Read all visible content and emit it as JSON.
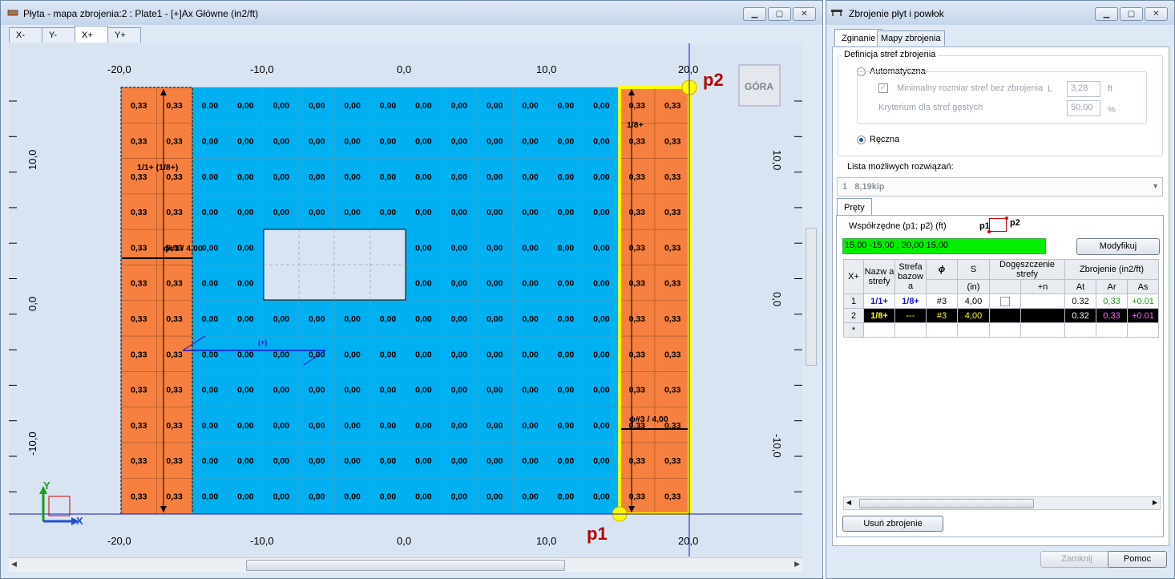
{
  "left_window": {
    "title": "Płyta - mapa zbrojenia:2 : Plate1 - [+]Ax Główne (in2/ft)",
    "tabs": [
      "X-",
      "Y-",
      "X+",
      "Y+"
    ],
    "active_tab": "X+",
    "top_axis_labels": [
      "-20,0",
      "-10,0",
      "0,0",
      "10,0",
      "20,0"
    ],
    "bottom_axis_labels": [
      "-20,0",
      "-10,0",
      "0,0",
      "10,0",
      "20,0"
    ],
    "left_axis_labels": [
      "10,0",
      "0,0",
      "-10,0"
    ],
    "right_axis_labels": [
      "10,0",
      "0,0",
      "-10,0"
    ],
    "view_cube": "GÓRA",
    "value_orange": "0,33",
    "value_blue": "0,00",
    "zone_label_left": "1/1+ (1/8+)",
    "zone_label_right": "1/8+",
    "bar_label_left": "ϕ#3 / 4,00",
    "bar_label_right": "ϕ#3 / 4,00",
    "direction_label": "(+)",
    "point_p1": "p1",
    "point_p2": "p2",
    "axis_x": "X",
    "axis_y": "Y",
    "colors": {
      "orange": "#f58040",
      "blue": "#00b0f0",
      "highlight": "#ffff00",
      "background": "#d9e4f3"
    }
  },
  "right_window": {
    "title": "Zbrojenie płyt i powłok",
    "tabs": [
      "Zginanie",
      "Mapy zbrojenia"
    ],
    "active_tab": "Zginanie",
    "group_title": "Definicja stref zbrojenia",
    "radio_auto": "Automatyczna",
    "check_min_label": "Minimalny rozmiar stref bez zbrojenia",
    "check_min_symbol": "L",
    "check_min_value": "3,28",
    "check_min_unit": "ft",
    "criterion_label": "Kryterium dla stref gęstych",
    "criterion_value": "50,00",
    "criterion_unit": "%",
    "radio_manual": "Ręczna",
    "solutions_label": "Lista możliwych rozwiązań:",
    "solution_index": "1",
    "solution_value": "8,19kip",
    "bars_tab": "Pręty",
    "coords_label": "Współrzędne (p1; p2) (ft)",
    "coords_p1": "p1",
    "coords_p2": "p2",
    "coords_value": "15,00 -15,00 ; 20,00 15,00",
    "modify_button": "Modyfikuj",
    "table": {
      "corner": "X+",
      "h_zone": "Nazw a strefy",
      "h_base": "Strefa bazow a",
      "h_phi": "ϕ",
      "h_s": "S",
      "h_s_unit": "(in)",
      "h_dense": "Dogęszczenie strefy",
      "h_dense_n": "+n",
      "h_reinf": "Zbrojenie (in2/ft)",
      "h_at": "At",
      "h_ar": "Ar",
      "h_as": "As",
      "rows": [
        {
          "num": "1",
          "zone": "1/1+",
          "base": "1/8+",
          "phi": "#3",
          "s": "4,00",
          "at": "0.32",
          "ar": "0,33",
          "as": "+0.01"
        },
        {
          "num": "2",
          "zone": "1/8+",
          "base": "---",
          "phi": "#3",
          "s": "4,00",
          "at": "0.32",
          "ar": "0,33",
          "as": "+0.01"
        }
      ],
      "new_row": "*"
    },
    "remove_button": "Usuń zbrojenie",
    "close_button": "Zamknij",
    "help_button": "Pomoc"
  }
}
